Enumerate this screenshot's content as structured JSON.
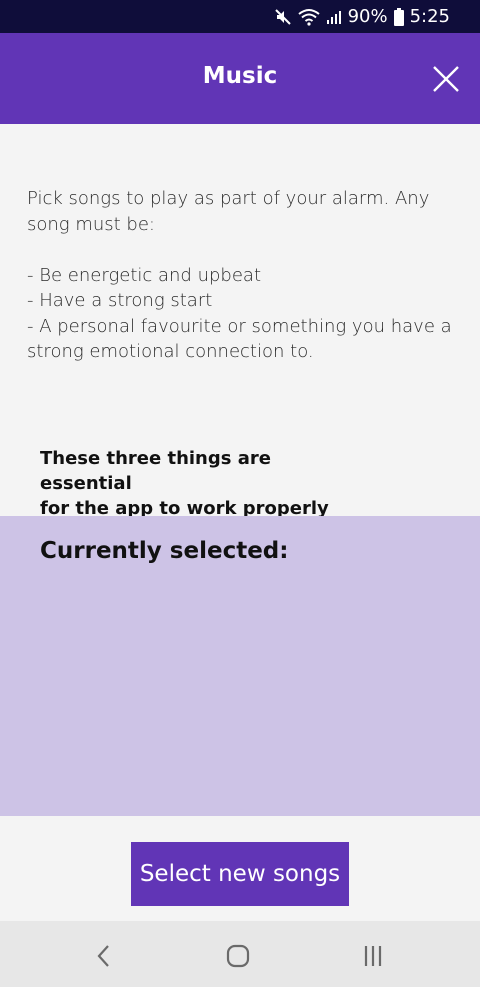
{
  "status_bar": {
    "battery": "90%",
    "time": "5:25"
  },
  "header": {
    "title": "Music"
  },
  "intro": {
    "paragraph": "Pick songs to play as part of your alarm. Any song must be:",
    "bullets": [
      "- Be energetic and upbeat",
      "- Have a strong start",
      "- A personal favourite or something you have a strong emotional connection to."
    ]
  },
  "notice": {
    "line1": "These three things are essential",
    "line2": "for the app to work properly"
  },
  "selected": {
    "heading": "Currently selected:"
  },
  "footer": {
    "select_button_label": "Select new songs"
  },
  "colors": {
    "status_bar": "#0f0d3a",
    "accent": "#6135b6",
    "panel": "#cdc3e6",
    "background": "#f4f4f4"
  }
}
